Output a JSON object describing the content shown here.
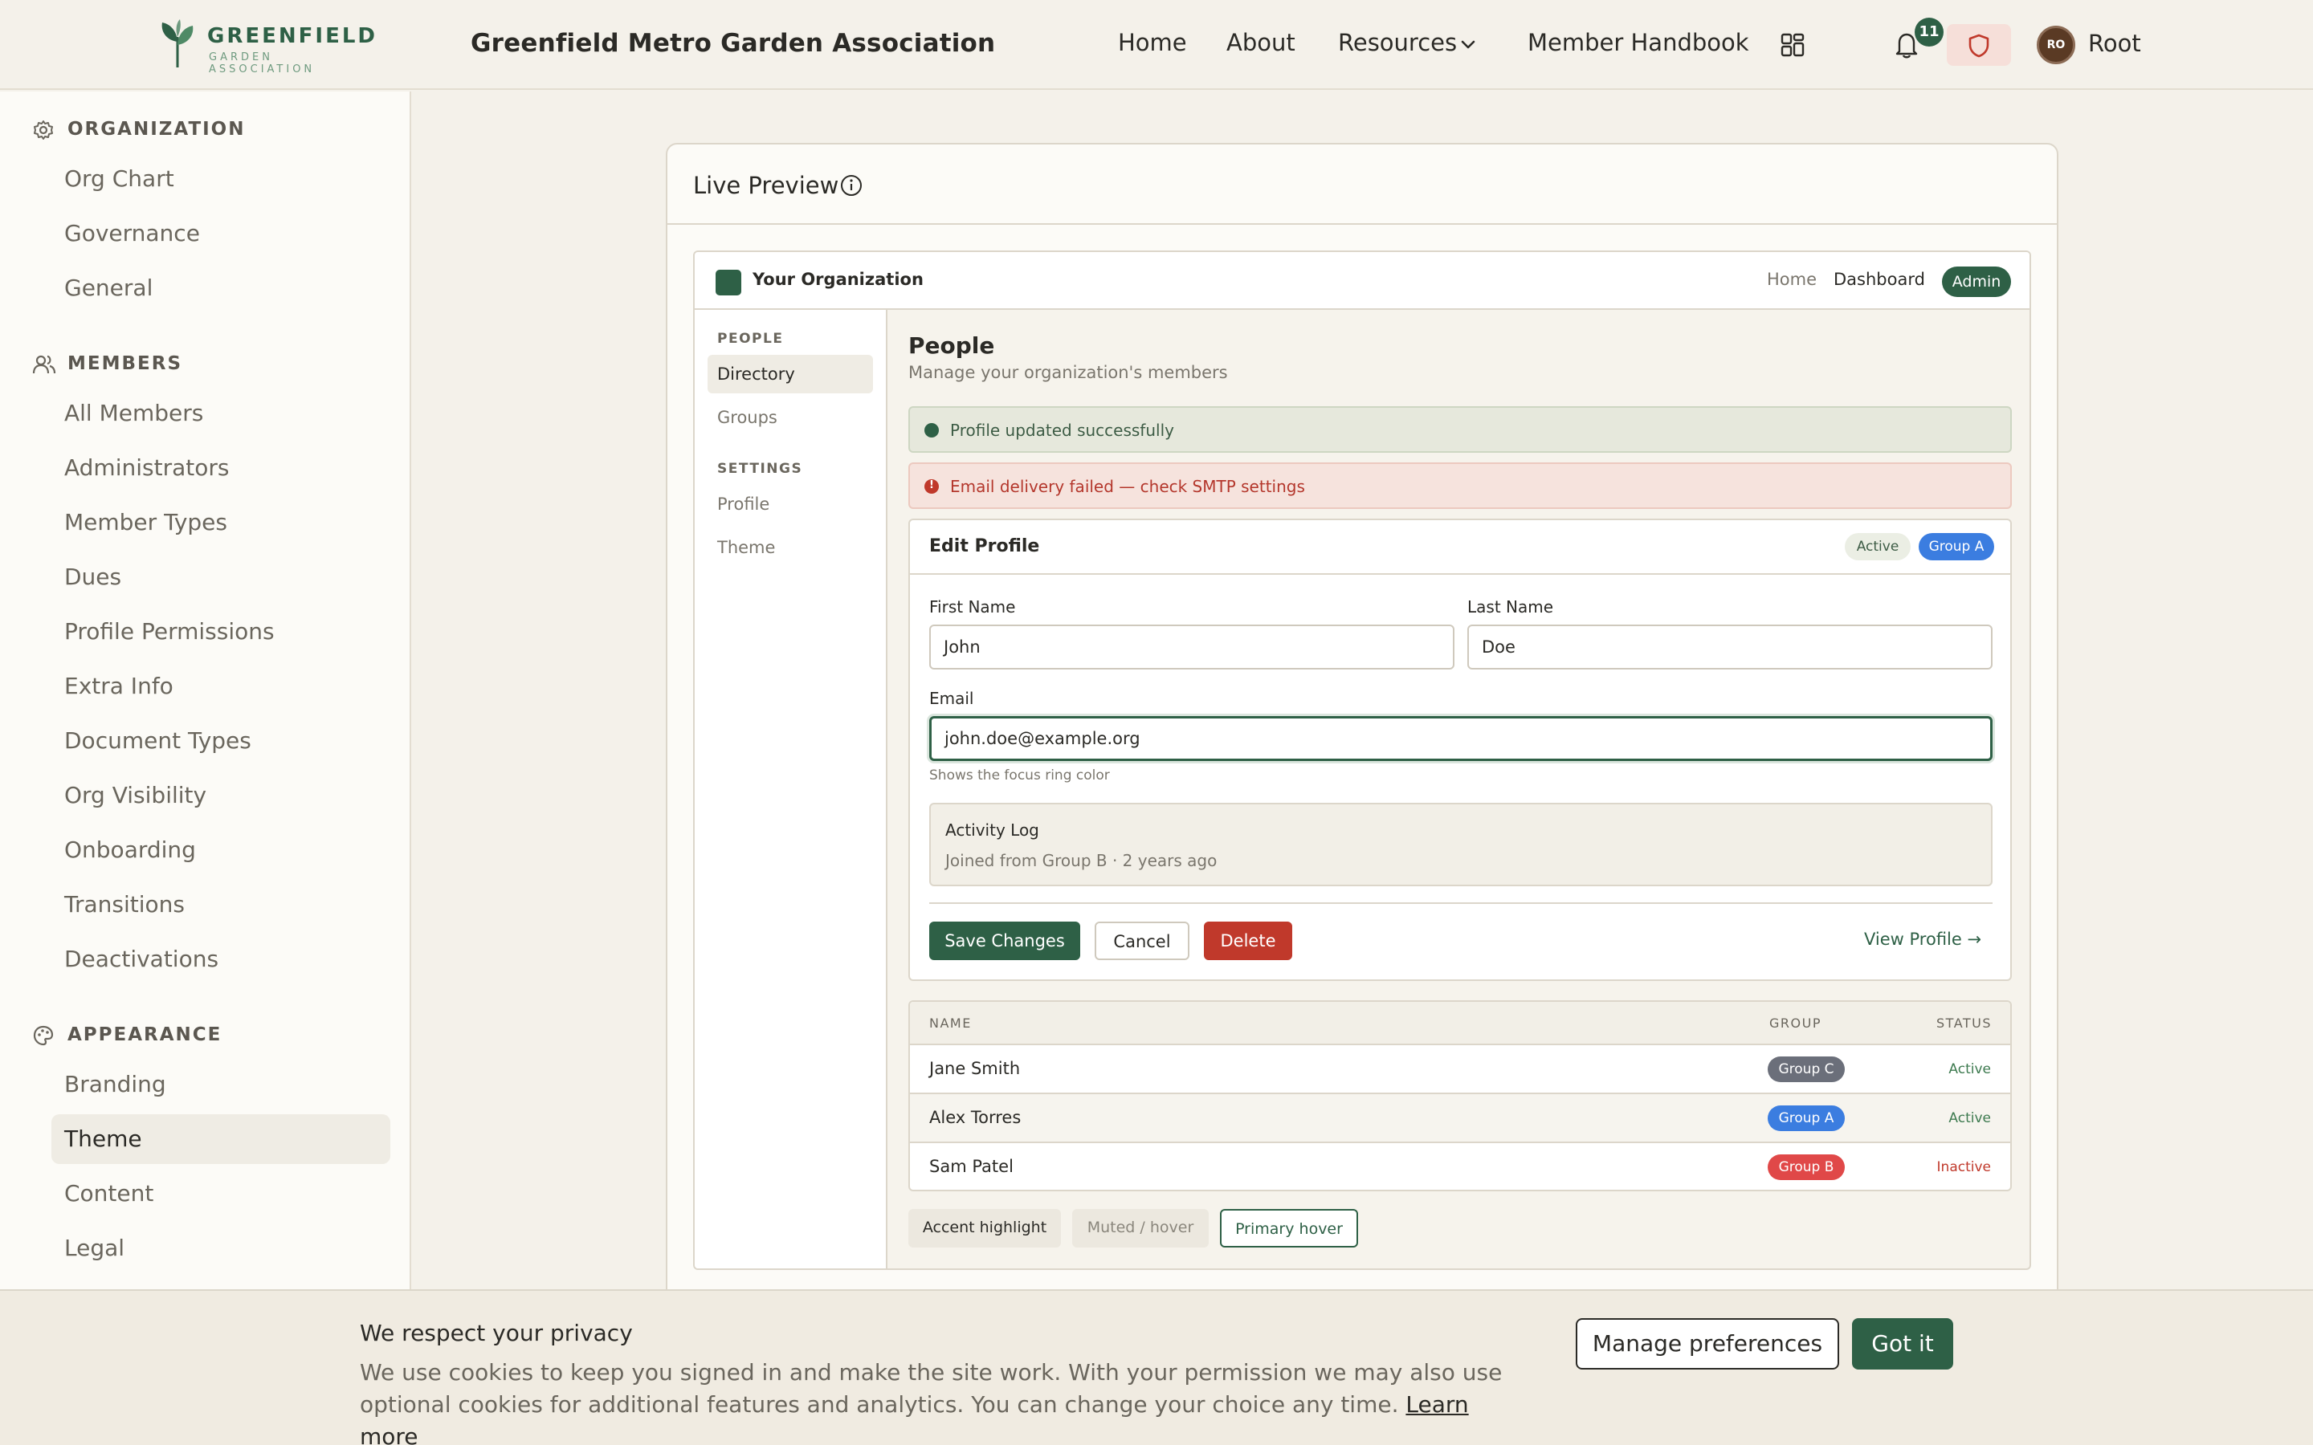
{
  "header": {
    "logo_word": "GREENFIELD",
    "logo_sub": "GARDEN ASSOCIATION",
    "site_title": "Greenfield Metro Garden Association",
    "nav": {
      "home": "Home",
      "about": "About",
      "resources": "Resources",
      "handbook": "Member Handbook"
    },
    "notification_count": "11",
    "user": {
      "initials": "RO",
      "name": "Root"
    }
  },
  "sidebar": {
    "sections": [
      {
        "title": "ORGANIZATION",
        "icon": "gear-icon",
        "items": [
          "Org Chart",
          "Governance",
          "General"
        ]
      },
      {
        "title": "MEMBERS",
        "icon": "users-icon",
        "items": [
          "All Members",
          "Administrators",
          "Member Types",
          "Dues",
          "Profile Permissions",
          "Extra Info",
          "Document Types",
          "Org Visibility",
          "Onboarding",
          "Transitions",
          "Deactivations"
        ]
      },
      {
        "title": "APPEARANCE",
        "icon": "palette-icon",
        "items": [
          "Branding",
          "Theme",
          "Content",
          "Legal"
        ]
      }
    ],
    "active_item": "Theme"
  },
  "panel": {
    "title": "Live Preview",
    "preview": {
      "org_name": "Your Organization",
      "nav": {
        "home": "Home",
        "dashboard": "Dashboard",
        "admin": "Admin"
      },
      "side": {
        "people_title": "PEOPLE",
        "people_items": [
          "Directory",
          "Groups"
        ],
        "settings_title": "SETTINGS",
        "settings_items": [
          "Profile",
          "Theme"
        ],
        "active_item": "Directory"
      },
      "heading": "People",
      "subheading": "Manage your organization's members",
      "alerts": {
        "success": "Profile updated successfully",
        "error": "Email delivery failed — check SMTP settings"
      },
      "card": {
        "title": "Edit Profile",
        "badge_status": "Active",
        "badge_group": "Group A",
        "first_name_label": "First Name",
        "first_name_value": "John",
        "last_name_label": "Last Name",
        "last_name_value": "Doe",
        "email_label": "Email",
        "email_value": "john.doe@example.org",
        "email_hint": "Shows the focus ring color",
        "activity_title": "Activity Log",
        "activity_text": "Joined from Group B · 2 years ago",
        "save": "Save Changes",
        "cancel": "Cancel",
        "delete": "Delete",
        "view_profile": "View Profile →"
      },
      "table": {
        "headers": {
          "name": "NAME",
          "group": "GROUP",
          "status": "STATUS"
        },
        "rows": [
          {
            "name": "Jane Smith",
            "group": "Group C",
            "status": "Active"
          },
          {
            "name": "Alex Torres",
            "group": "Group A",
            "status": "Active"
          },
          {
            "name": "Sam Patel",
            "group": "Group B",
            "status": "Inactive"
          }
        ]
      },
      "chips": {
        "accent": "Accent highlight",
        "muted": "Muted / hover",
        "primary": "Primary hover"
      }
    }
  },
  "cookie": {
    "title": "We respect your privacy",
    "text": "We use cookies to keep you signed in and make the site work. With your permission we may also use optional cookies for additional features and analytics. You can change your choice any time.",
    "link": "Learn more",
    "manage": "Manage preferences",
    "accept": "Got it"
  },
  "colors": {
    "primary": "#2e6046",
    "danger": "#c0392b",
    "group_a": "#3b7de0",
    "group_b": "#e04848",
    "group_c": "#6b6f7a",
    "background": "#f4f1ea"
  }
}
